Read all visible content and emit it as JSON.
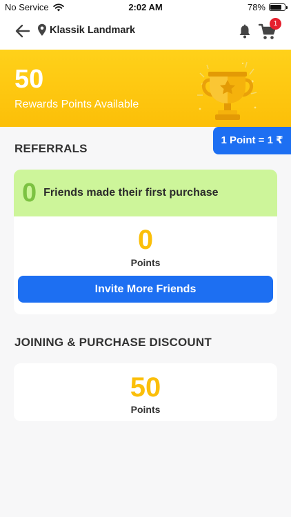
{
  "status_bar": {
    "carrier": "No Service",
    "time": "2:02 AM",
    "battery": "78%",
    "battery_level": 0.78
  },
  "header": {
    "location_title": "Klassik Landmark",
    "cart_count": "1",
    "icons": [
      "back-arrow-icon",
      "location-pin-icon",
      "bell-icon",
      "cart-icon"
    ]
  },
  "rewards": {
    "points": "50",
    "caption": "Rewards Points Available",
    "rate": "1 Point = 1 ₹"
  },
  "referrals": {
    "title": "REFERRALS",
    "friends_count": "0",
    "friends_label": "Friends made their first purchase",
    "points": "0",
    "points_label": "Points",
    "invite_label": "Invite More Friends"
  },
  "joining": {
    "title": "JOINING & PURCHASE DISCOUNT",
    "points": "50",
    "points_label": "Points"
  },
  "colors": {
    "accent_blue": "#1d6ff2",
    "banner_yellow": "#fcc80e",
    "points_yellow": "#fbbf0a",
    "friends_green": "#cdf59a",
    "badge_red": "#e5202e"
  }
}
